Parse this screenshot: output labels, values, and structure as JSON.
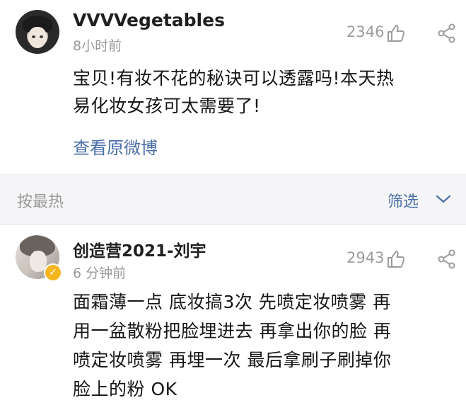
{
  "post": {
    "username": "VVVVegetables",
    "time": "8小时前",
    "likes": "2346",
    "text_lines": [
      "宝贝!有妆不花的秘诀可以透露吗!本天热",
      "易化妆女孩可太需要了!"
    ],
    "view_original": "查看原微博"
  },
  "sort_bar": {
    "sort_label": "按最热",
    "filter_label": "筛选"
  },
  "comment": {
    "username": "创造营2021-刘宇",
    "time": "6 分钟前",
    "likes": "2943",
    "verified_mark": "✓",
    "text_lines": [
      "面霜薄一点 底妆搞3次 先喷定妆喷雾 再",
      "用一盆散粉把脸埋进去 再拿出你的脸 再",
      "喷定妆喷雾 再埋一次 最后拿刷子刷掉你",
      "脸上的粉 OK"
    ]
  },
  "colors": {
    "link": "#4a6ea8",
    "muted": "#9a9a9a",
    "badge": "#f6b51e",
    "sortbar_bg": "#f5f5f7"
  },
  "icons": [
    "thumbs-up-icon",
    "share-icon",
    "chevron-down-icon",
    "verified-badge-icon"
  ]
}
